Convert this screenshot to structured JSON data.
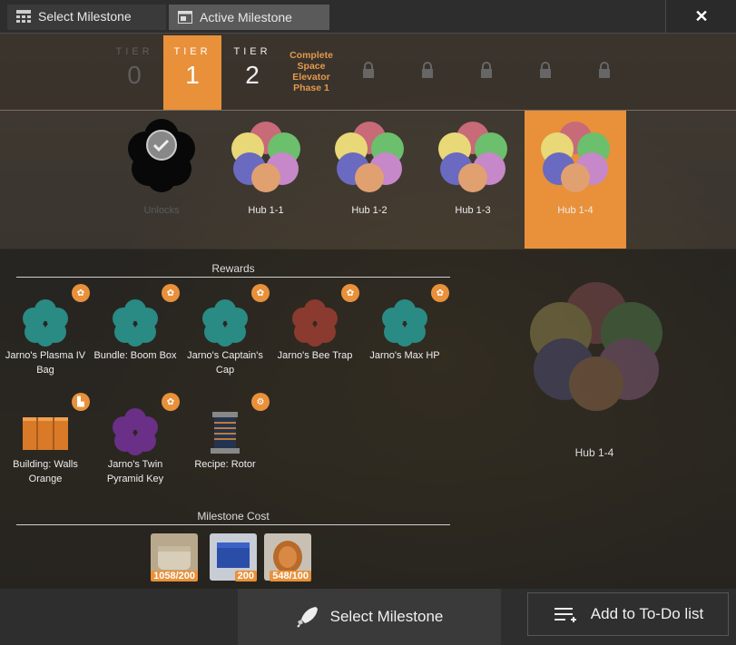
{
  "tabs": {
    "select": "Select Milestone",
    "active": "Active Milestone"
  },
  "close": "✕",
  "tiers": [
    {
      "label": "TIER",
      "number": "0"
    },
    {
      "label": "TIER",
      "number": "1"
    },
    {
      "label": "TIER",
      "number": "2"
    }
  ],
  "goal": "Complete Space Elevator Phase 1",
  "hubs": [
    {
      "name": "Unlocks"
    },
    {
      "name": "Hub 1-1"
    },
    {
      "name": "Hub 1-2"
    },
    {
      "name": "Hub 1-3"
    },
    {
      "name": "Hub 1-4"
    }
  ],
  "rewards_title": "Rewards",
  "rewards": [
    {
      "name": "Jarno's Plasma IV Bag"
    },
    {
      "name": "Bundle: Boom Box"
    },
    {
      "name": "Jarno's Captain's Cap"
    },
    {
      "name": "Jarno's Bee Trap"
    },
    {
      "name": "Jarno's Max HP"
    },
    {
      "name": "Building: Walls Orange"
    },
    {
      "name": "Jarno's Twin Pyramid Key"
    },
    {
      "name": "Recipe: Rotor"
    }
  ],
  "cost_title": "Milestone Cost",
  "costs": [
    {
      "amount": "1058/200"
    },
    {
      "amount": "200"
    },
    {
      "amount": "548/100"
    }
  ],
  "selected_hub_name": "Hub 1-4",
  "buttons": {
    "select": "Select Milestone",
    "todo": "Add to To-Do list"
  },
  "colors": {
    "accent": "#e8913a"
  },
  "icons": [
    "calendar-grid-icon",
    "window-icon",
    "close-icon",
    "lock-icon",
    "checkmark-icon",
    "gear-badge-icon",
    "factory-badge-icon",
    "rocket-icon",
    "todo-list-icon"
  ]
}
